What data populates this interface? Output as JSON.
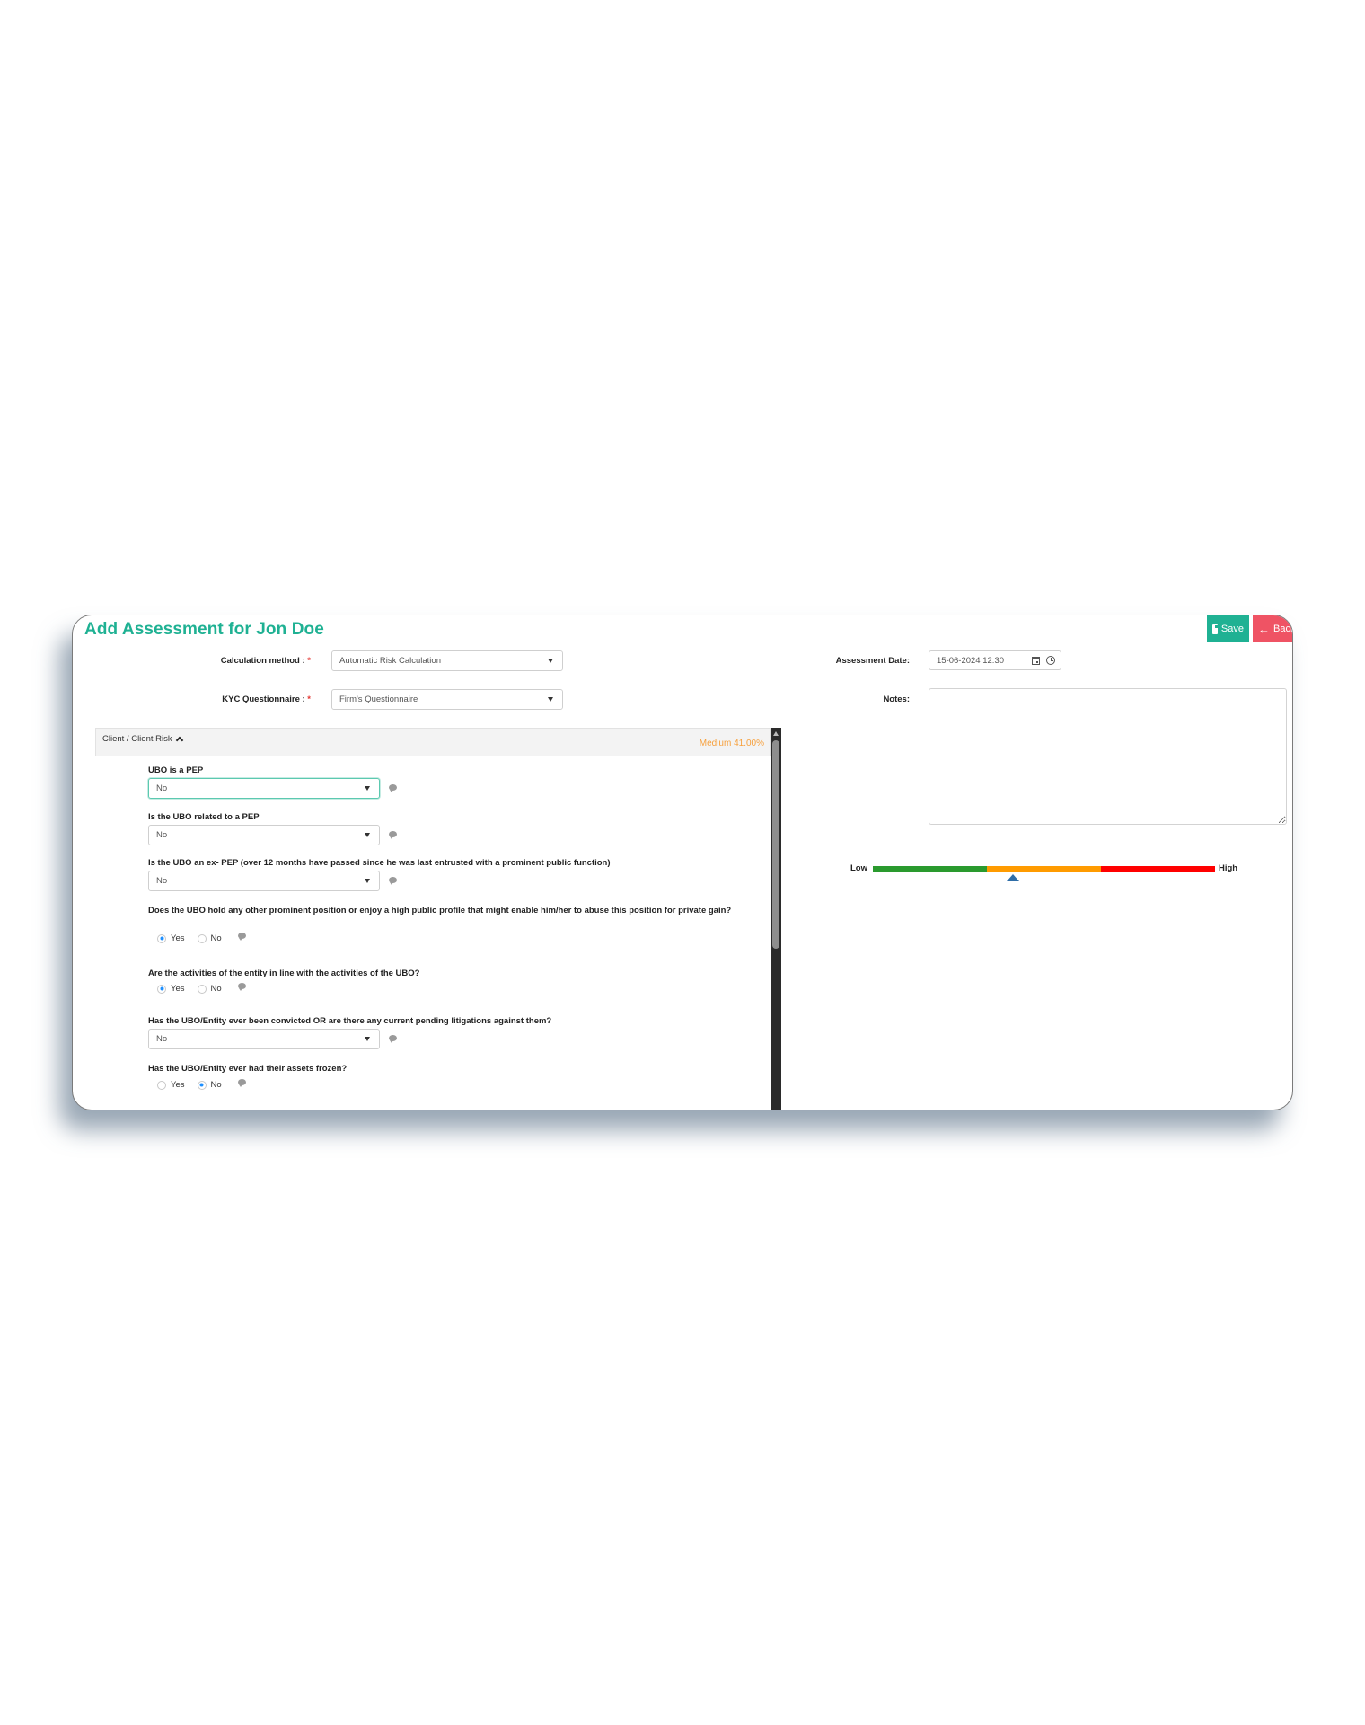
{
  "header": {
    "title": "Add Assessment for Jon Doe",
    "save_label": "Save",
    "back_label": "Back",
    "save_icon": "floppy-disk-icon",
    "back_icon": "arrow-left-icon"
  },
  "form": {
    "calculation_method": {
      "label": "Calculation method :",
      "required_mark": "*",
      "value": "Automatic Risk Calculation"
    },
    "kyc_questionnaire": {
      "label": "KYC Questionnaire :",
      "required_mark": "*",
      "value": "Firm's Questionnaire"
    },
    "assessment_date": {
      "label": "Assessment Date:",
      "value": "15-06-2024 12:30",
      "icons": [
        "calendar-icon",
        "clock-icon"
      ]
    },
    "notes": {
      "label": "Notes:",
      "value": ""
    }
  },
  "risk_meter": {
    "low_label": "Low",
    "high_label": "High",
    "segments": [
      {
        "name": "low",
        "color": "#2a9a2e"
      },
      {
        "name": "medium",
        "color": "#ff9b00"
      },
      {
        "name": "high",
        "color": "#ff0000"
      }
    ],
    "marker_value": 0.41,
    "marker_color": "#2f6ea8"
  },
  "section": {
    "title": "Client / Client Risk",
    "score_text": "Medium 41.00%",
    "score_color": "#f7a03c",
    "questions": [
      {
        "label": "UBO is a PEP",
        "type": "select",
        "value": "No",
        "focused": true
      },
      {
        "label": "Is the UBO related to a PEP",
        "type": "select",
        "value": "No"
      },
      {
        "label": "Is the UBO an ex- PEP (over 12 months have passed since he was last entrusted with a prominent public function)",
        "type": "select",
        "value": "No"
      },
      {
        "label": "Does the UBO hold any other prominent position or enjoy a high public profile that might enable him/her to abuse this position for private gain?",
        "type": "radio",
        "options": [
          "Yes",
          "No"
        ],
        "selected": "Yes"
      },
      {
        "label": "Are the activities of the entity in line with the activities of the UBO?",
        "type": "radio",
        "options": [
          "Yes",
          "No"
        ],
        "selected": "Yes"
      },
      {
        "label": "Has the UBO/Entity ever been convicted OR are there any current pending litigations against them?",
        "type": "select",
        "value": "No"
      },
      {
        "label": "Has the UBO/Entity ever had their assets frozen?",
        "type": "radio",
        "options": [
          "Yes",
          "No"
        ],
        "selected": "No"
      }
    ]
  },
  "colors": {
    "brand": "#1fb193",
    "save_button": "#1fb193",
    "back_button": "#ef5364",
    "focus_border": "#5cc9b0",
    "required": "#e53935"
  }
}
